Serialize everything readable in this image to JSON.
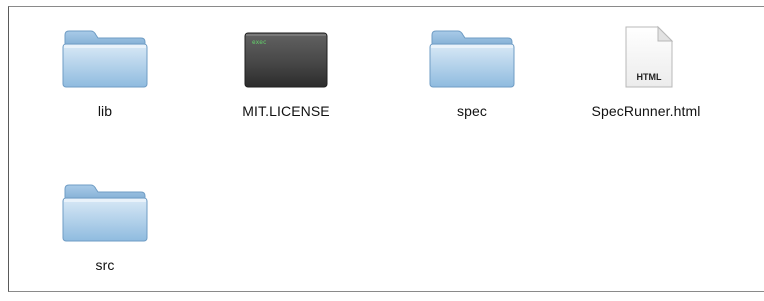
{
  "window": {
    "view": "icon-view"
  },
  "items": [
    {
      "name": "lib",
      "kind": "folder",
      "icon": "folder-icon"
    },
    {
      "name": "MIT.LICENSE",
      "kind": "executable",
      "icon": "exec-file-icon",
      "icon_text": "exec"
    },
    {
      "name": "spec",
      "kind": "folder",
      "icon": "folder-icon"
    },
    {
      "name": "SpecRunner.html",
      "kind": "document",
      "icon": "html-document-icon",
      "icon_text": "HTML"
    },
    {
      "name": "src",
      "kind": "folder",
      "icon": "folder-icon"
    }
  ],
  "colors": {
    "folder_light": "#c9dff0",
    "folder_dark": "#7faed4",
    "exec_top": "#5d5d5d",
    "exec_bottom": "#2f2f2f",
    "exec_text": "#62d36a"
  }
}
